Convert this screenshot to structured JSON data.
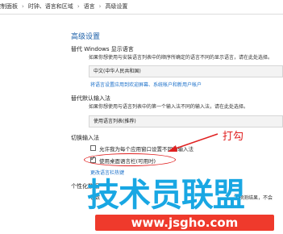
{
  "breadcrumb": [
    "控制面板",
    "时钟、语言和区域",
    "语言",
    "高级设置"
  ],
  "page_title": "高级设置",
  "override_display": {
    "heading": "替代 Windows 显示语言",
    "description": "如果你想使用与安装语言列表中的顺序所确定的语言不同的显示语言，请在此处选择。",
    "combo_value": "中文(中华人民共和国)",
    "link_language_settings": "将语言设置应用到欢迎屏幕、系统帐户和新用户帐户"
  },
  "override_input": {
    "heading": "替代默认输入法",
    "description": "如果你想使用与语言列表中的第一个输入法不同的输入法，请在此处选择。",
    "combo_value": "使用语言列表(推荐)"
  },
  "switch_input": {
    "heading": "切换输入法",
    "option_per_app": "允许我为每个应用窗口设置不同的输入法",
    "option_per_app_checked": false,
    "option_desktop_bar": "使用桌面语言栏(可用时)",
    "option_desktop_bar_checked": true,
    "link_hotkeys": "更改语言栏热键"
  },
  "personalization": {
    "heading": "个性化数据",
    "description_left": "该数",
    "description_right": "字预测结果，不会"
  },
  "annotation": "打勾",
  "watermark": {
    "brand": "技术员联盟",
    "url": "www.jsgho.com"
  },
  "colors": {
    "title_blue": "#1b5fa8",
    "link_blue": "#1a6fc9",
    "annotation_red": "#e02020",
    "watermark_blue": "#19a7e3",
    "url_bg_red": "#ef3a2c"
  }
}
